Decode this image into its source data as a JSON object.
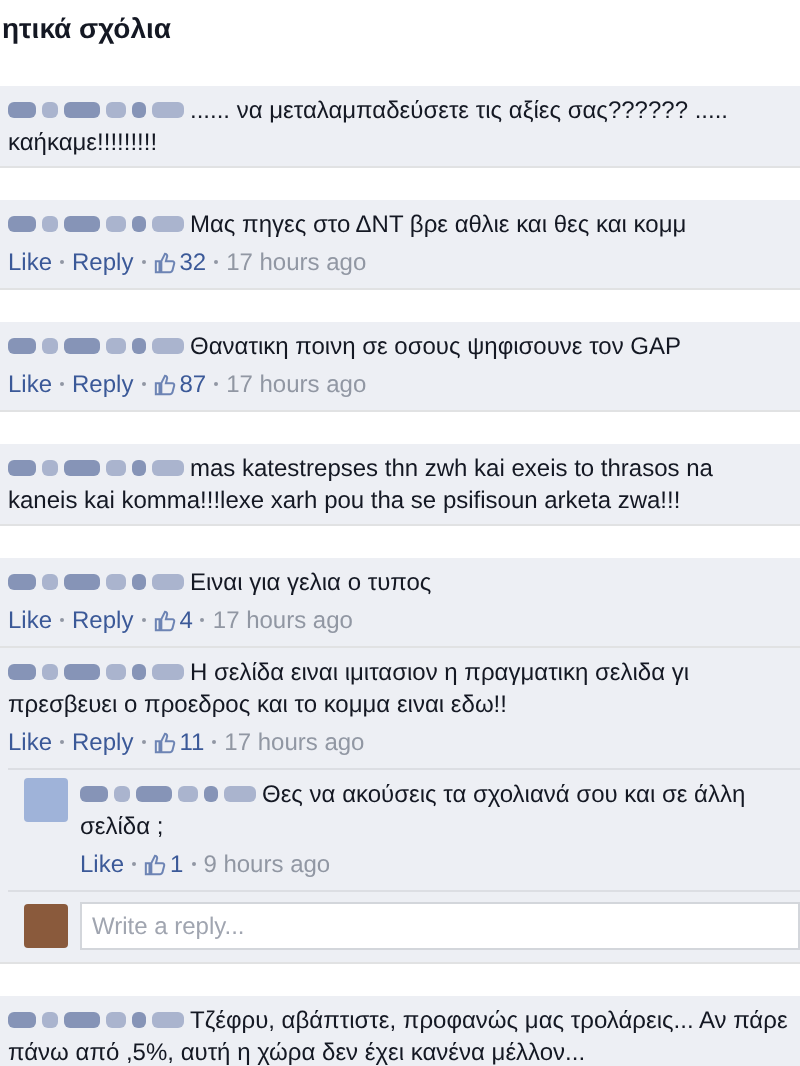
{
  "heading": "ητικά σχόλια",
  "comments": [
    {
      "lines": [
        "...... να μεταλαμπαδεύσετε τις αξίες σας?????? .....",
        "καήκαμε!!!!!!!!!"
      ],
      "gap_after": true
    },
    {
      "lines": [
        "Μας πηγες στο ΔΝΤ βρε αθλιε και θες και κομμ"
      ],
      "actions": [
        {
          "kind": "link",
          "text": "Like"
        },
        {
          "kind": "link",
          "text": "Reply"
        },
        {
          "kind": "likes",
          "text": "32"
        },
        {
          "kind": "time",
          "text": "17 hours ago"
        }
      ],
      "gap_after": true
    },
    {
      "lines": [
        "Θανατικη ποινη σε οσους ψηφισουνε τον GAP"
      ],
      "actions": [
        {
          "kind": "link",
          "text": "Like"
        },
        {
          "kind": "link",
          "text": "Reply"
        },
        {
          "kind": "likes",
          "text": "87"
        },
        {
          "kind": "time",
          "text": "17 hours ago"
        }
      ],
      "gap_after": true
    },
    {
      "lines": [
        "mas katestrepses thn zwh kai exeis to thrasos na",
        "kaneis kai komma!!!lexe xarh pou tha se psifisoun arketa zwa!!!"
      ],
      "gap_after": true
    },
    {
      "lines": [
        "Ειναι για γελια ο τυπος"
      ],
      "actions": [
        {
          "kind": "link",
          "text": "Like"
        },
        {
          "kind": "link",
          "text": "Reply"
        },
        {
          "kind": "likes",
          "text": "4"
        },
        {
          "kind": "time",
          "text": "17 hours ago"
        }
      ],
      "gap_after": false
    },
    {
      "lines": [
        "Η σελίδα ειναι ιμιτασιον η πραγματικη σελιδα γι",
        "πρεσβευει ο προεδρος και το κομμα ειναι εδω!!"
      ],
      "actions": [
        {
          "kind": "link",
          "text": "Like"
        },
        {
          "kind": "link",
          "text": "Reply"
        },
        {
          "kind": "likes",
          "text": "11"
        },
        {
          "kind": "time",
          "text": "17 hours ago"
        }
      ],
      "replies": [
        {
          "lines": [
            "Θες να ακούσεις τα σχολιανά σου και σε άλλη",
            "σελίδα ;"
          ],
          "actions": [
            {
              "kind": "link",
              "text": "Like"
            },
            {
              "kind": "likes",
              "text": "1"
            },
            {
              "kind": "time",
              "text": "9 hours ago"
            }
          ]
        }
      ],
      "reply_field": {
        "placeholder": "Write a reply..."
      },
      "gap_after": true
    },
    {
      "lines": [
        "Τζέφρυ, αβάπτιστε, προφανώς μας τρολάρεις... Αν πάρε",
        "πάνω από ,5%, αυτή η χώρα δεν έχει κανένα μέλλον..."
      ],
      "gap_after": false
    }
  ]
}
